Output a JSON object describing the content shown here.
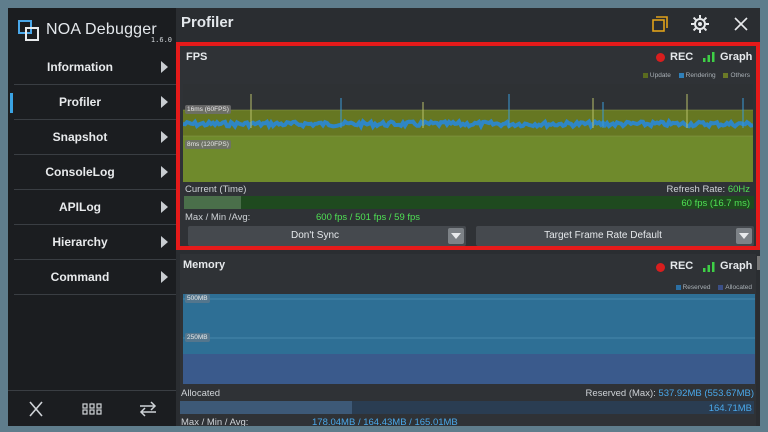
{
  "app": {
    "title": "NOA Debugger",
    "version": "1.6.0"
  },
  "sidebar": {
    "items": [
      {
        "label": "Information",
        "active": false
      },
      {
        "label": "Profiler",
        "active": true
      },
      {
        "label": "Snapshot",
        "active": false
      },
      {
        "label": "ConsoleLog",
        "active": false
      },
      {
        "label": "APILog",
        "active": false
      },
      {
        "label": "Hierarchy",
        "active": false
      },
      {
        "label": "Command",
        "active": false
      }
    ],
    "bottom_icons": [
      "close-icon",
      "grid-icon",
      "swap-icon"
    ]
  },
  "header": {
    "title": "Profiler",
    "icons": [
      "window-icon",
      "gear-icon",
      "close-icon"
    ]
  },
  "fps": {
    "title": "FPS",
    "rec_label": "REC",
    "graph_label": "Graph",
    "legend": [
      {
        "label": "Update",
        "color": "#5a6b1f"
      },
      {
        "label": "Rendering",
        "color": "#2f7fb8"
      },
      {
        "label": "Others",
        "color": "#6b7a27"
      }
    ],
    "ticks": {
      "upper": "16ms (60FPS)",
      "lower": "8ms (120FPS)"
    },
    "current_label": "Current (Time)",
    "refresh_label": "Refresh Rate:",
    "refresh_value": "60Hz",
    "current_value": "60 fps (16.7 ms)",
    "current_fraction": 0.1,
    "maxminavg_label": "Max / Min /Avg:",
    "maxminavg_value": "600 fps / 501 fps / 59 fps",
    "sync_dropdown": "Don't Sync",
    "target_dropdown": "Target Frame Rate Default"
  },
  "memory": {
    "title": "Memory",
    "rec_label": "REC",
    "graph_label": "Graph",
    "legend": [
      {
        "label": "Reserved",
        "color": "#2b6fa3"
      },
      {
        "label": "Allocated",
        "color": "#3b4f86"
      }
    ],
    "ticks": {
      "upper": "500MB",
      "lower": "250MB"
    },
    "allocated_label": "Allocated",
    "reserved_label": "Reserved (Max):",
    "reserved_value": "537.92MB (553.67MB)",
    "current_value": "164.71MB",
    "current_fraction": 0.3,
    "maxminavg_label": "Max / Min / Avg:",
    "maxminavg_value": "178.04MB / 164.43MB / 165.01MB"
  },
  "colors": {
    "accent_red": "#e51a1a",
    "green_text": "#4fe054",
    "blue_text": "#4aa8ea"
  }
}
